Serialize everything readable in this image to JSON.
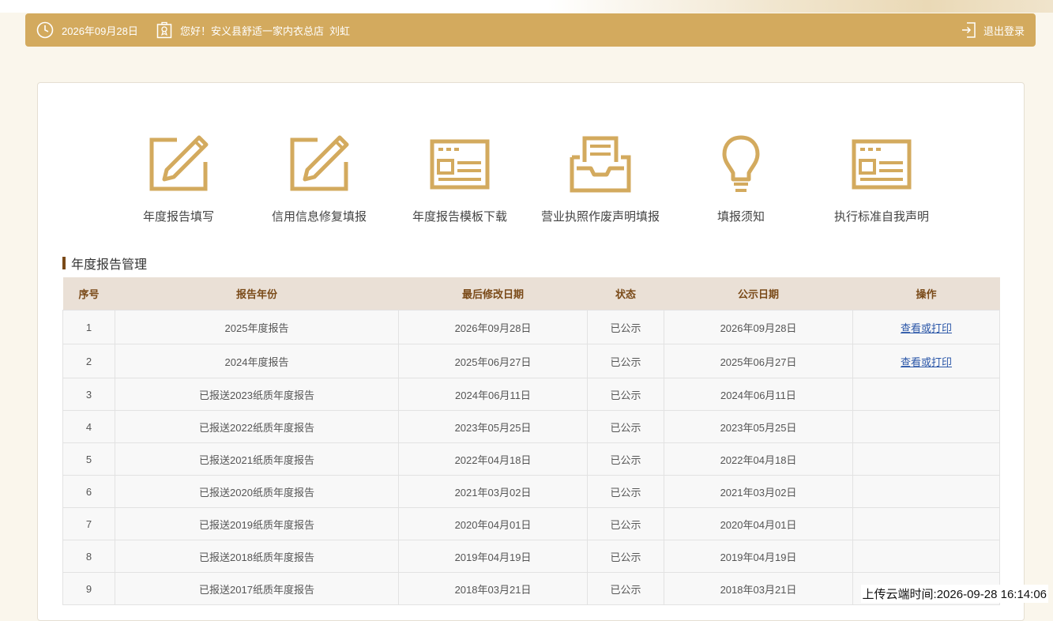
{
  "header": {
    "date": "2026年09月28日",
    "greeting": "您好！安义县舒适一家内衣总店",
    "user": "刘虹",
    "logout": "退出登录",
    "icons": [
      "clock-icon",
      "certificate-icon",
      "logout-icon"
    ]
  },
  "tiles": [
    {
      "label": "年度报告填写",
      "icon": "edit-document-icon"
    },
    {
      "label": "信用信息修复填报",
      "icon": "edit-document-icon"
    },
    {
      "label": "年度报告模板下载",
      "icon": "form-template-icon"
    },
    {
      "label": "营业执照作废声明填报",
      "icon": "inbox-document-icon"
    },
    {
      "label": "填报须知",
      "icon": "lightbulb-icon"
    },
    {
      "label": "执行标准自我声明",
      "icon": "form-template-icon"
    }
  ],
  "section": {
    "title": "年度报告管理"
  },
  "table": {
    "headers": [
      "序号",
      "报告年份",
      "最后修改日期",
      "状态",
      "公示日期",
      "操作"
    ],
    "rows": [
      {
        "no": "1",
        "year": "2025年度报告",
        "modified": "2026年09月28日",
        "status": "已公示",
        "published": "2026年09月28日",
        "action": "查看或打印"
      },
      {
        "no": "2",
        "year": "2024年度报告",
        "modified": "2025年06月27日",
        "status": "已公示",
        "published": "2025年06月27日",
        "action": "查看或打印"
      },
      {
        "no": "3",
        "year": "已报送2023纸质年度报告",
        "modified": "2024年06月11日",
        "status": "已公示",
        "published": "2024年06月11日",
        "action": ""
      },
      {
        "no": "4",
        "year": "已报送2022纸质年度报告",
        "modified": "2023年05月25日",
        "status": "已公示",
        "published": "2023年05月25日",
        "action": ""
      },
      {
        "no": "5",
        "year": "已报送2021纸质年度报告",
        "modified": "2022年04月18日",
        "status": "已公示",
        "published": "2022年04月18日",
        "action": ""
      },
      {
        "no": "6",
        "year": "已报送2020纸质年度报告",
        "modified": "2021年03月02日",
        "status": "已公示",
        "published": "2021年03月02日",
        "action": ""
      },
      {
        "no": "7",
        "year": "已报送2019纸质年度报告",
        "modified": "2020年04月01日",
        "status": "已公示",
        "published": "2020年04月01日",
        "action": ""
      },
      {
        "no": "8",
        "year": "已报送2018纸质年度报告",
        "modified": "2019年04月19日",
        "status": "已公示",
        "published": "2019年04月19日",
        "action": ""
      },
      {
        "no": "9",
        "year": "已报送2017纸质年度报告",
        "modified": "2018年03月21日",
        "status": "已公示",
        "published": "2018年03月21日",
        "action": ""
      }
    ]
  },
  "watermark": "上传云端时间:2026-09-28 16:14:06",
  "colors": {
    "accent": "#d3aa5e",
    "header_text": "#7a4a18",
    "link": "#2b57a8"
  }
}
